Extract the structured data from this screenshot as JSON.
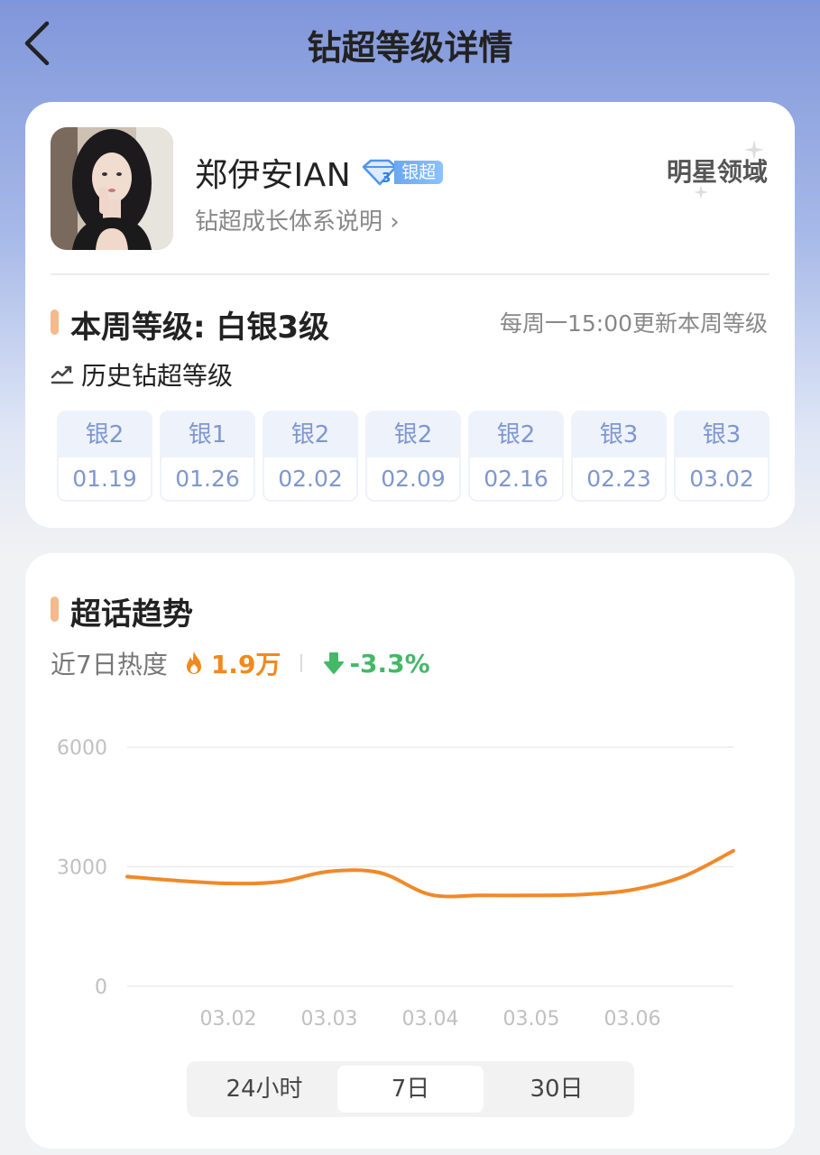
{
  "header": {
    "title": "钻超等级详情"
  },
  "profile": {
    "name": "郑伊安IAN",
    "badge_level": "3",
    "badge_label": "银超",
    "growth_link": "钻超成长体系说明 ›",
    "domain_label": "明星领域"
  },
  "week": {
    "level_label": "本周等级: 白银3级",
    "update_note": "每周一15:00更新本周等级"
  },
  "history": {
    "label": "历史钻超等级",
    "items": [
      {
        "level": "银2",
        "date": "01.19"
      },
      {
        "level": "银1",
        "date": "01.26"
      },
      {
        "level": "银2",
        "date": "02.02"
      },
      {
        "level": "银2",
        "date": "02.09"
      },
      {
        "level": "银2",
        "date": "02.16"
      },
      {
        "level": "银3",
        "date": "02.23"
      },
      {
        "level": "银3",
        "date": "03.02"
      }
    ]
  },
  "trend": {
    "title": "超话趋势",
    "heat_label": "近7日热度",
    "heat_value": "1.9万",
    "change_value": "-3.3%"
  },
  "chart_data": {
    "type": "line",
    "title": "",
    "xlabel": "",
    "ylabel": "",
    "ylim": [
      0,
      6000
    ],
    "yticks": [
      "6000",
      "3000",
      "0"
    ],
    "xticks": [
      "03.02",
      "03.03",
      "03.04",
      "03.05",
      "03.06"
    ],
    "x": [
      0,
      0.5,
      1,
      1.5,
      2,
      2.5,
      3,
      3.5,
      4,
      4.5,
      5,
      5.5,
      6
    ],
    "series": [
      {
        "values": [
          2750,
          2650,
          2580,
          2620,
          2880,
          2850,
          2300,
          2280,
          2280,
          2300,
          2420,
          2750,
          3400
        ],
        "color": "#f0892a"
      }
    ],
    "grid": true
  },
  "range_tabs": [
    "24小时",
    "7日",
    "30日"
  ],
  "active_tab": "7日"
}
